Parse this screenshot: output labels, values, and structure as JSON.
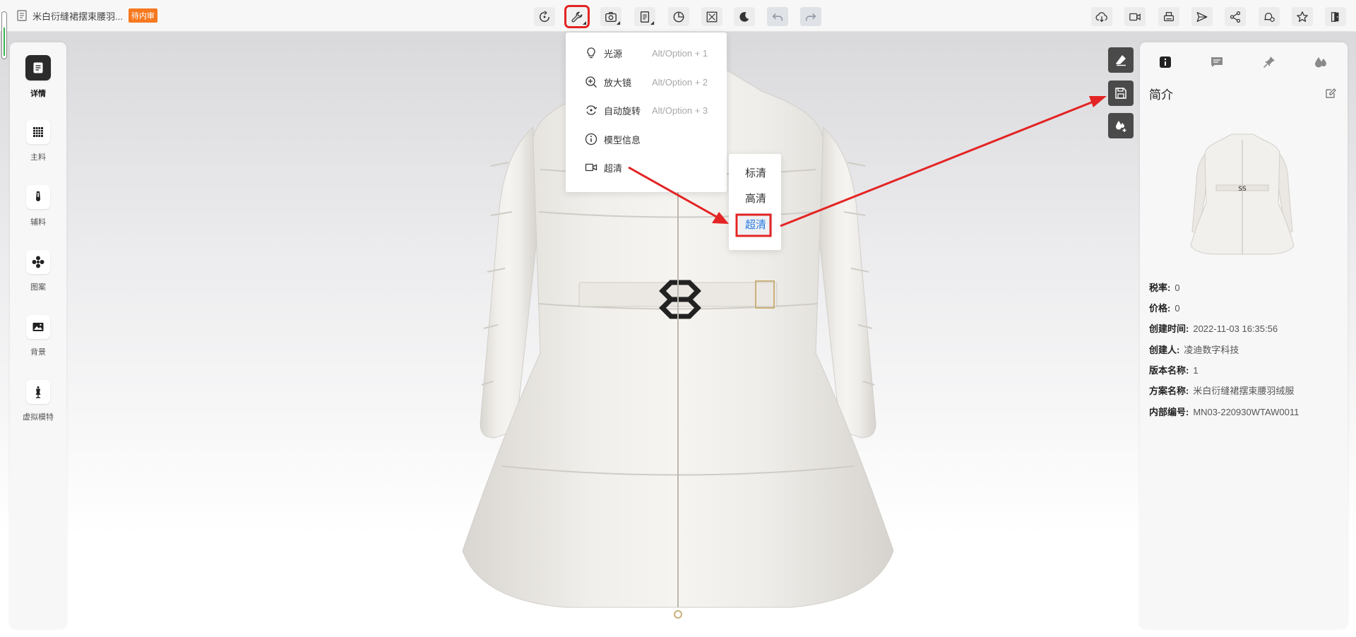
{
  "header": {
    "doc_title": "米白衍缝裙摆束腰羽...",
    "status_badge": "待内审"
  },
  "toolbar_center": [
    {
      "name": "rotate-reset-icon"
    },
    {
      "name": "wrench-icon",
      "highlighted": true
    },
    {
      "name": "camera-icon"
    },
    {
      "name": "document-icon"
    },
    {
      "name": "pie-chart-icon"
    },
    {
      "name": "fit-screen-icon"
    },
    {
      "name": "moon-icon"
    },
    {
      "name": "undo-icon",
      "disabled": true
    },
    {
      "name": "redo-icon",
      "disabled": true
    }
  ],
  "toolbar_right": [
    {
      "name": "cloud-download-icon"
    },
    {
      "name": "video-camera-icon"
    },
    {
      "name": "printer-icon"
    },
    {
      "name": "send-icon"
    },
    {
      "name": "share-icon"
    },
    {
      "name": "bell-clock-icon"
    },
    {
      "name": "star-icon"
    },
    {
      "name": "exit-icon"
    }
  ],
  "sidebar": {
    "items": [
      {
        "label": "详情",
        "icon": "document-icon",
        "active": true
      },
      {
        "label": "主料",
        "icon": "fabric-grid-icon"
      },
      {
        "label": "辅料",
        "icon": "zipper-icon"
      },
      {
        "label": "图案",
        "icon": "pattern-icon"
      },
      {
        "label": "背景",
        "icon": "image-icon"
      },
      {
        "label": "虚拟模特",
        "icon": "mannequin-icon"
      }
    ]
  },
  "tool_menu": {
    "items": [
      {
        "label": "光源",
        "shortcut": "Alt/Option + 1",
        "icon": "bulb-icon"
      },
      {
        "label": "放大镜",
        "shortcut": "Alt/Option + 2",
        "icon": "zoom-in-icon"
      },
      {
        "label": "自动旋转",
        "shortcut": "Alt/Option + 3",
        "icon": "auto-rotate-icon"
      },
      {
        "label": "模型信息",
        "shortcut": "",
        "icon": "info-icon"
      },
      {
        "label": "超清",
        "shortcut": "",
        "icon": "video-icon"
      }
    ]
  },
  "quality_submenu": {
    "options": [
      "标清",
      "高清",
      "超清"
    ],
    "selected": "超清"
  },
  "right_float_buttons": [
    {
      "name": "eraser-icon"
    },
    {
      "name": "save-icon"
    },
    {
      "name": "add-color-icon"
    }
  ],
  "right_panel": {
    "tabs": [
      {
        "name": "info-icon",
        "active": true
      },
      {
        "name": "comment-icon"
      },
      {
        "name": "pin-icon"
      },
      {
        "name": "drops-icon"
      }
    ],
    "title": "简介",
    "info": [
      {
        "label": "税率:",
        "value": "0"
      },
      {
        "label": "价格:",
        "value": "0"
      },
      {
        "label": "创建时间:",
        "value": "2022-11-03 16:35:56"
      },
      {
        "label": "创建人:",
        "value": "凌迪数字科技"
      },
      {
        "label": "版本名称:",
        "value": "1"
      },
      {
        "label": "方案名称:",
        "value": "米白衍缝裙摆束腰羽绒服"
      },
      {
        "label": "内部编号:",
        "value": "MN03-220930WTAW0011"
      }
    ]
  },
  "colors": {
    "accent": "#2a7be0",
    "badge": "#f6781f",
    "annotation": "#e32424",
    "float_button": "#4a4a4a"
  }
}
